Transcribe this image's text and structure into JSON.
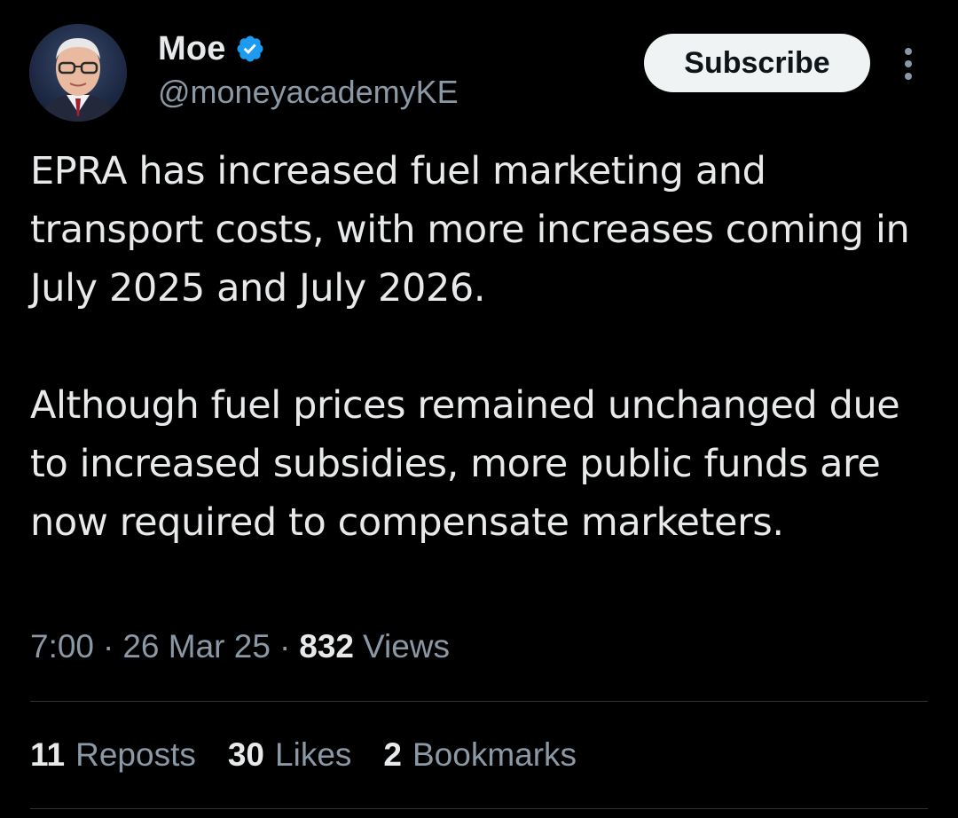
{
  "author": {
    "display_name": "Moe",
    "handle": "@moneyacademyKE",
    "verified": true,
    "avatar_icon": "profile-photo"
  },
  "actions": {
    "subscribe_label": "Subscribe",
    "more_icon": "more-vertical-icon"
  },
  "tweet": {
    "paragraphs": [
      "EPRA has increased fuel marketing and transport costs, with more increases coming in July 2025 and July 2026.",
      "Although fuel prices remained unchanged due to increased subsidies, more public funds are now required to compensate marketers."
    ]
  },
  "meta": {
    "time": "7:00",
    "date": "26 Mar 25",
    "views_count": "832",
    "views_label": "Views"
  },
  "stats": {
    "reposts_count": "11",
    "reposts_label": "Reposts",
    "likes_count": "30",
    "likes_label": "Likes",
    "bookmarks_count": "2",
    "bookmarks_label": "Bookmarks"
  },
  "colors": {
    "background": "#000000",
    "text_primary": "#e7e9ea",
    "text_secondary": "#8b98a5",
    "verified_badge": "#1d9bf0",
    "button_bg": "#eff3f4"
  }
}
